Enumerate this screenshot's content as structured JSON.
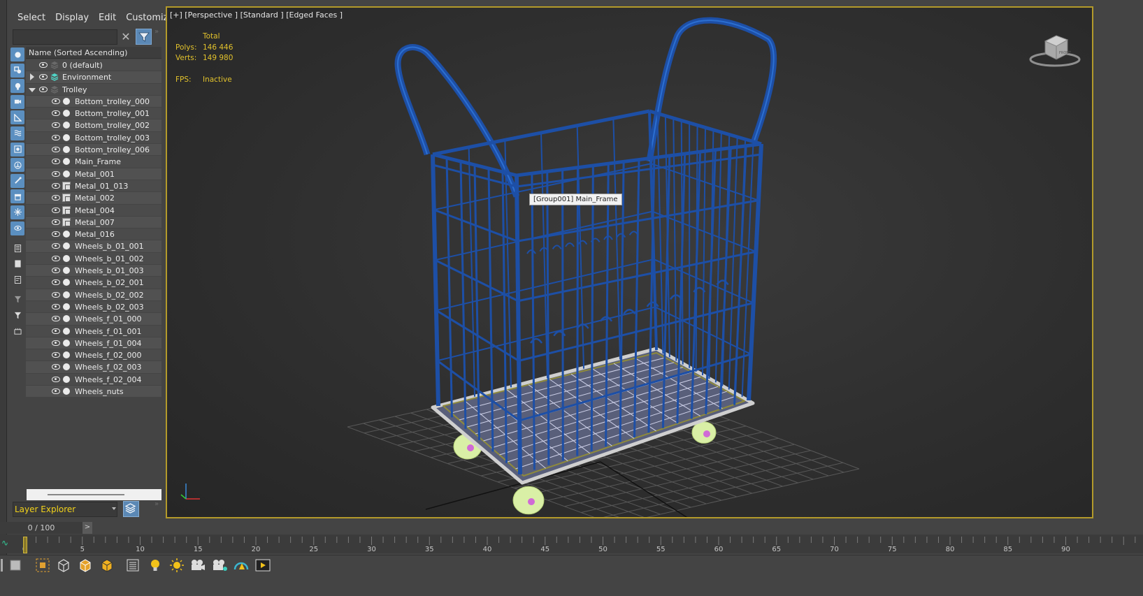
{
  "menu": [
    "Select",
    "Display",
    "Edit",
    "Customize"
  ],
  "search": {
    "placeholder": ""
  },
  "tree": {
    "header": "Name (Sorted Ascending)",
    "items": [
      {
        "label": "0 (default)",
        "level": 0,
        "kind": "layer",
        "expander": "none"
      },
      {
        "label": "Environment",
        "level": 0,
        "kind": "layer-active",
        "expander": "closed"
      },
      {
        "label": "Trolley",
        "level": 0,
        "kind": "layer",
        "expander": "open"
      },
      {
        "label": "Bottom_trolley_000",
        "level": 1,
        "kind": "object"
      },
      {
        "label": "Bottom_trolley_001",
        "level": 1,
        "kind": "object"
      },
      {
        "label": "Bottom_trolley_002",
        "level": 1,
        "kind": "object"
      },
      {
        "label": "Bottom_trolley_003",
        "level": 1,
        "kind": "object"
      },
      {
        "label": "Bottom_trolley_006",
        "level": 1,
        "kind": "object"
      },
      {
        "label": "Main_Frame",
        "level": 1,
        "kind": "object"
      },
      {
        "label": "Metal_001",
        "level": 1,
        "kind": "object"
      },
      {
        "label": "Metal_01_013",
        "level": 1,
        "kind": "group"
      },
      {
        "label": "Metal_002",
        "level": 1,
        "kind": "group"
      },
      {
        "label": "Metal_004",
        "level": 1,
        "kind": "group"
      },
      {
        "label": "Metal_007",
        "level": 1,
        "kind": "group"
      },
      {
        "label": "Metal_016",
        "level": 1,
        "kind": "object"
      },
      {
        "label": "Wheels_b_01_001",
        "level": 1,
        "kind": "object"
      },
      {
        "label": "Wheels_b_01_002",
        "level": 1,
        "kind": "object"
      },
      {
        "label": "Wheels_b_01_003",
        "level": 1,
        "kind": "object"
      },
      {
        "label": "Wheels_b_02_001",
        "level": 1,
        "kind": "object"
      },
      {
        "label": "Wheels_b_02_002",
        "level": 1,
        "kind": "object"
      },
      {
        "label": "Wheels_b_02_003",
        "level": 1,
        "kind": "object"
      },
      {
        "label": "Wheels_f_01_000",
        "level": 1,
        "kind": "object"
      },
      {
        "label": "Wheels_f_01_001",
        "level": 1,
        "kind": "object"
      },
      {
        "label": "Wheels_f_01_004",
        "level": 1,
        "kind": "object"
      },
      {
        "label": "Wheels_f_02_000",
        "level": 1,
        "kind": "object"
      },
      {
        "label": "Wheels_f_02_003",
        "level": 1,
        "kind": "object"
      },
      {
        "label": "Wheels_f_02_004",
        "level": 1,
        "kind": "object"
      },
      {
        "label": "Wheels_nuts",
        "level": 1,
        "kind": "object"
      }
    ]
  },
  "layer_explorer": {
    "label": "Layer Explorer"
  },
  "frame_counter": {
    "value": "0 / 100",
    "next": ">"
  },
  "viewport": {
    "label": "[+] [Perspective ] [Standard ] [Edged Faces ]",
    "stats": {
      "total_label": "Total",
      "polys_label": "Polys:",
      "polys_value": "146 446",
      "verts_label": "Verts:",
      "verts_value": "149 980",
      "fps_label": "FPS:",
      "fps_value": "Inactive"
    },
    "tooltip": "[Group001] Main_Frame",
    "viewcube_label": "FRONT"
  },
  "timeline": {
    "ticks": [
      "0",
      "5",
      "10",
      "15",
      "20",
      "25",
      "30",
      "35",
      "40",
      "45",
      "50",
      "55",
      "60",
      "65",
      "70",
      "75",
      "80",
      "85",
      "90"
    ],
    "current_frame": 0
  },
  "colors": {
    "accent": "#5b88b5",
    "viewport_border": "#b39a2a",
    "stats_text": "#e2c22c",
    "wire_blue": "#1d4fa6"
  }
}
